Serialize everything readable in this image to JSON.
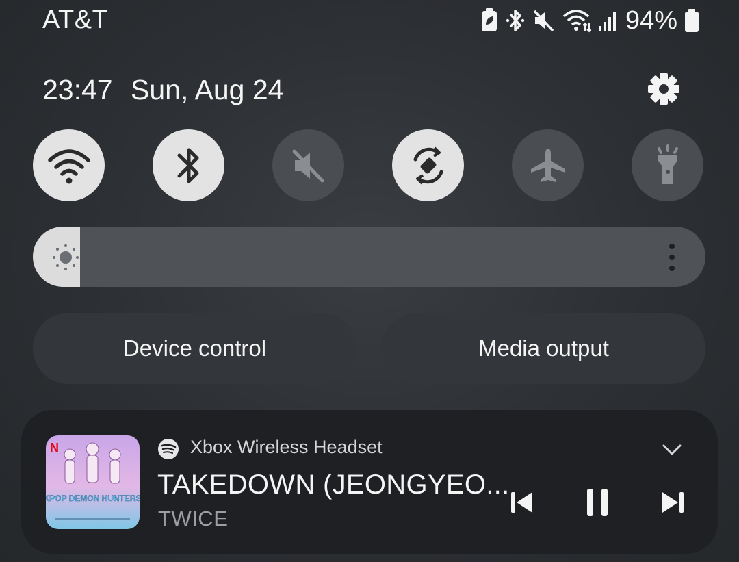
{
  "status_bar": {
    "carrier": "AT&T",
    "battery_percent": "94%",
    "icons": [
      "battery-saver-icon",
      "bluetooth-icon",
      "mute-icon",
      "wifi-icon",
      "signal-icon",
      "battery-icon"
    ]
  },
  "header": {
    "time": "23:47",
    "date": "Sun, Aug 24",
    "settings_icon": "gear-icon"
  },
  "quick_tiles": [
    {
      "name": "wifi",
      "icon": "wifi-icon",
      "state": "on"
    },
    {
      "name": "bluetooth",
      "icon": "bluetooth-icon",
      "state": "on"
    },
    {
      "name": "sound",
      "icon": "mute-icon",
      "state": "off"
    },
    {
      "name": "auto-rotate",
      "icon": "rotate-icon",
      "state": "on"
    },
    {
      "name": "airplane-mode",
      "icon": "airplane-icon",
      "state": "off"
    },
    {
      "name": "flashlight",
      "icon": "flashlight-icon",
      "state": "off"
    }
  ],
  "brightness": {
    "level": 0.07,
    "icon": "sun-icon",
    "menu_icon": "more-vertical-icon"
  },
  "buttons": {
    "device_control": "Device control",
    "media_output": "Media output"
  },
  "media": {
    "app_icon": "spotify-icon",
    "device": "Xbox Wireless Headset",
    "title": "TAKEDOWN (JEONGYEO...",
    "artist": "TWICE",
    "album_art_text": "KPOP DEMON HUNTERS",
    "controls": {
      "previous": "previous-icon",
      "pause": "pause-icon",
      "next": "next-icon"
    },
    "expand_icon": "chevron-down-icon"
  }
}
